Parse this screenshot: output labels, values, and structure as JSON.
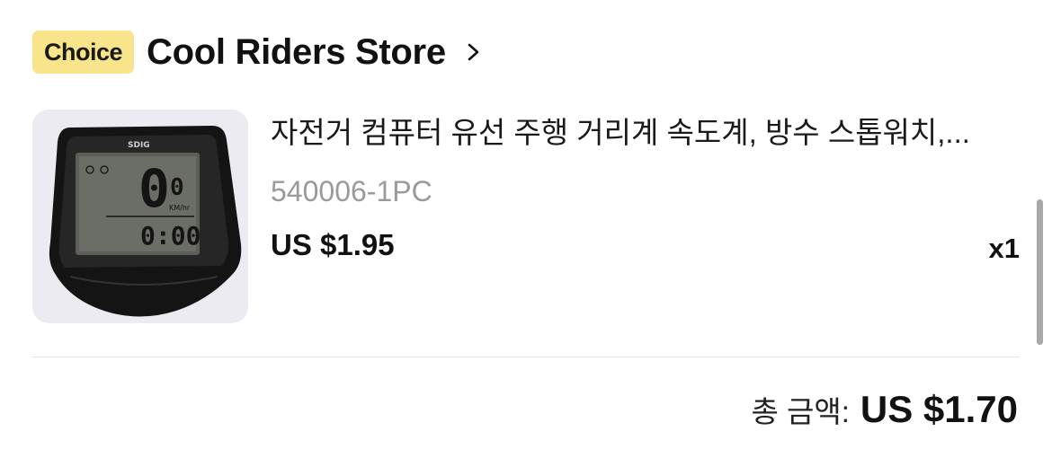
{
  "store": {
    "badge": "Choice",
    "name": "Cool Riders Store",
    "chevron_icon": "chevron-right-icon"
  },
  "product": {
    "image_icon": "bike-computer-image",
    "title": "자전거 컴퓨터 유선 주행 거리계 속도계, 방수 스톱워치,...",
    "variant": "540006-1PC",
    "price": "US $1.95",
    "quantity": "x1"
  },
  "summary": {
    "total_label": "총 금액:",
    "total_value": "US $1.70"
  },
  "colors": {
    "badge_bg": "#f8e48a",
    "thumb_bg": "#ecebf1",
    "variant_text": "#9a9a9a"
  }
}
